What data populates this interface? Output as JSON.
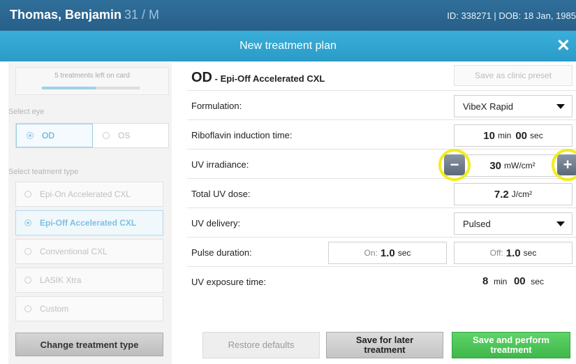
{
  "header": {
    "patient_name": "Thomas, Benjamin",
    "patient_age_sex": "31 / M",
    "id_dob": "ID: 338271 | DOB: 18 Jan, 1985"
  },
  "title": "New treatment plan",
  "sidebar": {
    "treatments_left": "5 treatments left on card",
    "treatments_left_fraction": 0.55,
    "select_eye_label": "Select eye",
    "eye_options": [
      "OD",
      "OS"
    ],
    "selected_eye": "OD",
    "select_type_label": "Select teatment type",
    "types": [
      "Epi-On Accelerated CXL",
      "Epi-Off Accelerated CXL",
      "Conventional CXL",
      "LASIK Xtra",
      "Custom"
    ],
    "selected_type": "Epi-Off Accelerated CXL",
    "change_button": "Change treatment type"
  },
  "plan": {
    "eye": "OD",
    "name": "- Epi-Off Accelerated CXL",
    "preset_button": "Save as clinic preset",
    "rows": {
      "formulation": {
        "label": "Formulation:",
        "value": "VibeX Rapid"
      },
      "induction": {
        "label": "Riboflavin induction time:",
        "min": "10",
        "min_unit": "min",
        "sec": "00",
        "sec_unit": "sec"
      },
      "irradiance": {
        "label": "UV irradiance:",
        "value": "30",
        "unit": "mW/cm²"
      },
      "dose": {
        "label": "Total UV dose:",
        "value": "7.2",
        "unit": "J/cm²"
      },
      "delivery": {
        "label": "UV delivery:",
        "value": "Pulsed"
      },
      "pulse": {
        "label": "Pulse duration:",
        "on_label": "On:",
        "on_value": "1.0",
        "off_label": "Off:",
        "off_value": "1.0",
        "unit": "sec"
      },
      "exposure": {
        "label": "UV exposure time:",
        "min": "8",
        "min_unit": "min",
        "sec": "00",
        "sec_unit": "sec"
      }
    }
  },
  "footer": {
    "restore": "Restore defaults",
    "save_later_1": "Save for later",
    "save_later_2": "treatment",
    "save_perform_1": "Save and perform",
    "save_perform_2": "treatment"
  },
  "colors": {
    "header": "#2f6f9a",
    "title_bar": "#3aaed8",
    "accent": "#3fa7d6",
    "perform": "#4cc556",
    "highlight": "#f2ec1c"
  }
}
